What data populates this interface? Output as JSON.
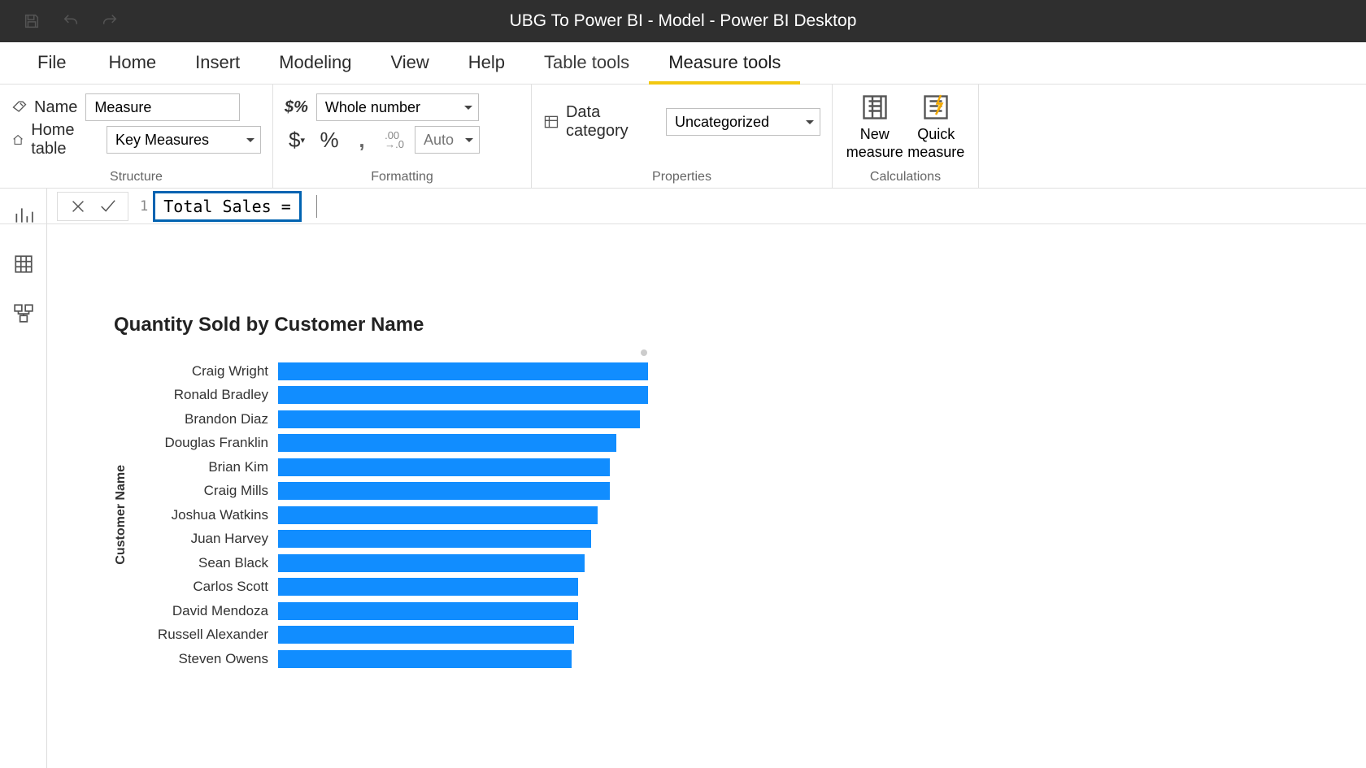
{
  "window": {
    "title": "UBG To Power BI - Model - Power BI Desktop"
  },
  "tabs": {
    "file": "File",
    "items": [
      "Home",
      "Insert",
      "Modeling",
      "View",
      "Help",
      "Table tools",
      "Measure tools"
    ],
    "active": "Measure tools"
  },
  "ribbon": {
    "structure": {
      "label": "Structure",
      "name_label": "Name",
      "name_value": "Measure",
      "home_table_label": "Home table",
      "home_table_value": "Key Measures"
    },
    "formatting": {
      "label": "Formatting",
      "format_value": "Whole number",
      "decimal_placeholder": "Auto"
    },
    "properties": {
      "label": "Properties",
      "data_category_label": "Data category",
      "data_category_value": "Uncategorized"
    },
    "calculations": {
      "label": "Calculations",
      "new_measure": "New measure",
      "quick_measure": "Quick measure"
    }
  },
  "formula_bar": {
    "line_no": "1",
    "text": "Total Sales ="
  },
  "chart_data": {
    "type": "bar",
    "title": "Quantity Sold by Customer Name",
    "ylabel": "Customer Name",
    "xlabel": "",
    "max_value": 350,
    "categories": [
      "Craig Wright",
      "Ronald Bradley",
      "Brandon Diaz",
      "Douglas Franklin",
      "Brian Kim",
      "Craig Mills",
      "Joshua Watkins",
      "Juan Harvey",
      "Sean Black",
      "Carlos Scott",
      "David Mendoza",
      "Russell Alexander",
      "Steven Owens"
    ],
    "values": [
      348,
      348,
      340,
      318,
      312,
      312,
      300,
      294,
      288,
      282,
      282,
      278,
      276
    ]
  }
}
